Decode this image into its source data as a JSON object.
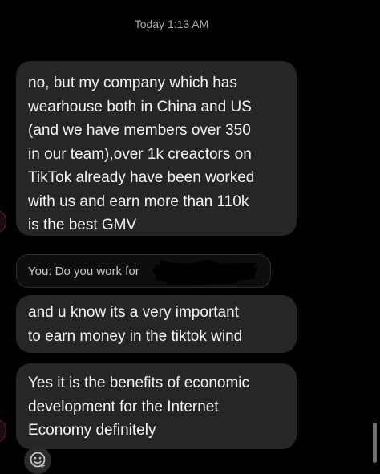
{
  "header": {
    "timestamp": "Today 1:13 AM"
  },
  "messages": [
    {
      "sender": "them",
      "text": "no,   but my company which has\nwearhouse both in China and US\n(and we have members over 350\nin our team),over 1k creactors on\nTikTok already have been worked\nwith us and earn more than 110k\nis the best GMV"
    },
    {
      "sender": "me",
      "reply_preview": "You: Do you work for"
    },
    {
      "sender": "them",
      "text": "and u know its a very important\nto earn money in the tiktok wind"
    },
    {
      "sender": "them",
      "text": "Yes it is the benefits of economic\ndevelopment for the Internet\nEconomy definitely"
    }
  ],
  "icons": {
    "sticker_button": "sticker-smiley-icon",
    "redaction": "redaction-scribble"
  },
  "colors": {
    "background": "#000000",
    "bubble": "#262628",
    "timestamp_text": "#a9a9ae",
    "avatar_ring": "#6b1f2e"
  }
}
